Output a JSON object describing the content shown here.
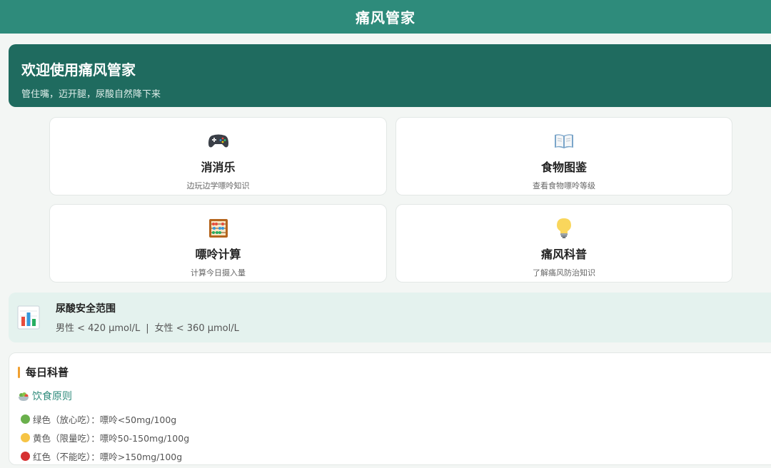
{
  "header": {
    "title": "痛风管家"
  },
  "hero": {
    "title": "欢迎使用痛风管家",
    "subtitle": "管住嘴，迈开腿，尿酸自然降下来"
  },
  "features": [
    {
      "icon": "gamepad-icon",
      "title": "消消乐",
      "desc": "边玩边学嘌呤知识"
    },
    {
      "icon": "book-icon",
      "title": "食物图鉴",
      "desc": "查看食物嘌呤等级"
    },
    {
      "icon": "abacus-icon",
      "title": "嘌呤计算",
      "desc": "计算今日摄入量"
    },
    {
      "icon": "lightbulb-icon",
      "title": "痛风科普",
      "desc": "了解痛风防治知识"
    }
  ],
  "uric_range": {
    "icon": "bar-chart-icon",
    "title": "尿酸安全范围",
    "male": "男性 < 420 μmol/L",
    "separator": "|",
    "female": "女性 < 360 μmol/L"
  },
  "daily": {
    "title": "每日科普",
    "principle": {
      "icon": "salad-bowl-icon",
      "label": "饮食原则"
    },
    "rules": [
      {
        "color": "#6ab04c",
        "text": "绿色（放心吃）：嘌呤<50mg/100g"
      },
      {
        "color": "#f6c445",
        "text": "黄色（限量吃）：嘌呤50-150mg/100g"
      },
      {
        "color": "#d63031",
        "text": "红色（不能吃）：嘌呤>150mg/100g"
      }
    ]
  },
  "colors": {
    "header_bg": "#2e8b7b",
    "hero_bg": "#1f6b5f",
    "range_bg": "#e4f2ee",
    "accent": "#f0a030"
  }
}
